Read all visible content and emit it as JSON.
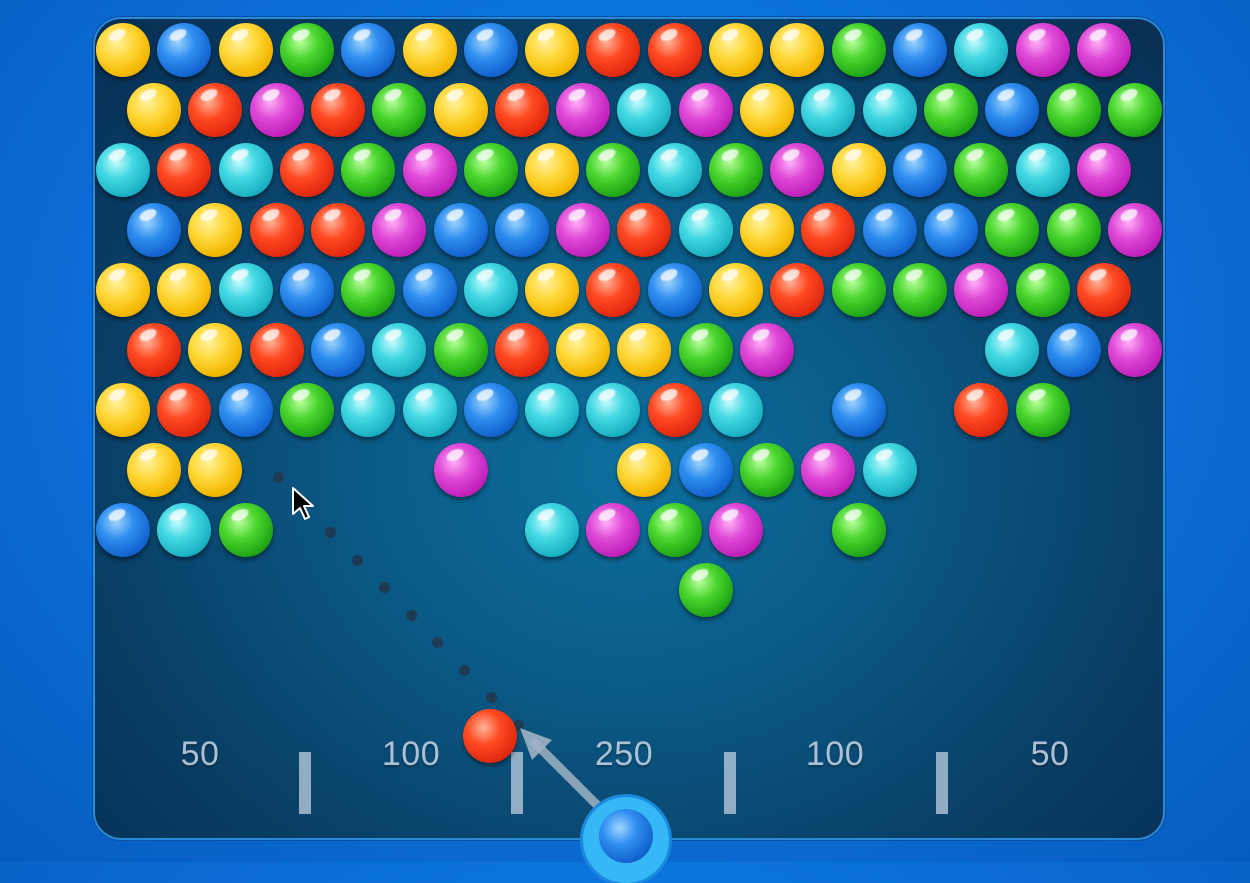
{
  "game": {
    "score_zones": [
      "50",
      "100",
      "250",
      "100",
      "50"
    ],
    "colors": {
      "yellow": "#f2b600",
      "blue": "#1465d0",
      "green": "#22a816",
      "red": "#e22a10",
      "magenta": "#c122bb",
      "cyan": "#1db3c4"
    },
    "current_bubble_color": "red",
    "next_bubble_color": "blue",
    "grid_rows": [
      [
        "yellow",
        "blue",
        "yellow",
        "green",
        "blue",
        "yellow",
        "blue",
        "yellow",
        "red",
        "red",
        "yellow",
        "yellow",
        "green",
        "blue",
        "cyan",
        "magenta",
        "magenta"
      ],
      [
        "yellow",
        "red",
        "magenta",
        "red",
        "green",
        "yellow",
        "red",
        "magenta",
        "cyan",
        "magenta",
        "yellow",
        "cyan",
        "cyan",
        "green",
        "blue",
        "green",
        "green"
      ],
      [
        "cyan",
        "red",
        "cyan",
        "red",
        "green",
        "magenta",
        "green",
        "yellow",
        "green",
        "cyan",
        "green",
        "magenta",
        "yellow",
        "blue",
        "green",
        "cyan",
        "magenta"
      ],
      [
        "blue",
        "yellow",
        "red",
        "red",
        "magenta",
        "blue",
        "blue",
        "magenta",
        "red",
        "cyan",
        "yellow",
        "red",
        "blue",
        "blue",
        "green",
        "green",
        "magenta"
      ],
      [
        "yellow",
        "yellow",
        "cyan",
        "blue",
        "green",
        "blue",
        "cyan",
        "yellow",
        "red",
        "blue",
        "yellow",
        "red",
        "green",
        "green",
        "magenta",
        "green",
        "red"
      ],
      [
        "red",
        "yellow",
        "red",
        "blue",
        "cyan",
        "green",
        "red",
        "yellow",
        "yellow",
        "green",
        "magenta",
        null,
        null,
        null,
        "cyan",
        "blue",
        "magenta"
      ],
      [
        "yellow",
        "red",
        "blue",
        "green",
        "cyan",
        "cyan",
        "blue",
        "cyan",
        "cyan",
        "red",
        "cyan",
        null,
        "blue",
        null,
        "red",
        "green",
        null
      ],
      [
        "yellow",
        "yellow",
        null,
        null,
        null,
        "magenta",
        null,
        null,
        "yellow",
        "blue",
        "green",
        "magenta",
        "cyan",
        null,
        null,
        null,
        null
      ],
      [
        "blue",
        "cyan",
        "green",
        null,
        null,
        null,
        null,
        "cyan",
        "magenta",
        "green",
        "magenta",
        null,
        "green",
        null,
        null,
        null,
        null
      ],
      [
        null,
        null,
        null,
        null,
        null,
        null,
        null,
        null,
        null,
        "green",
        null,
        null,
        null,
        null,
        null,
        null,
        null
      ]
    ]
  }
}
